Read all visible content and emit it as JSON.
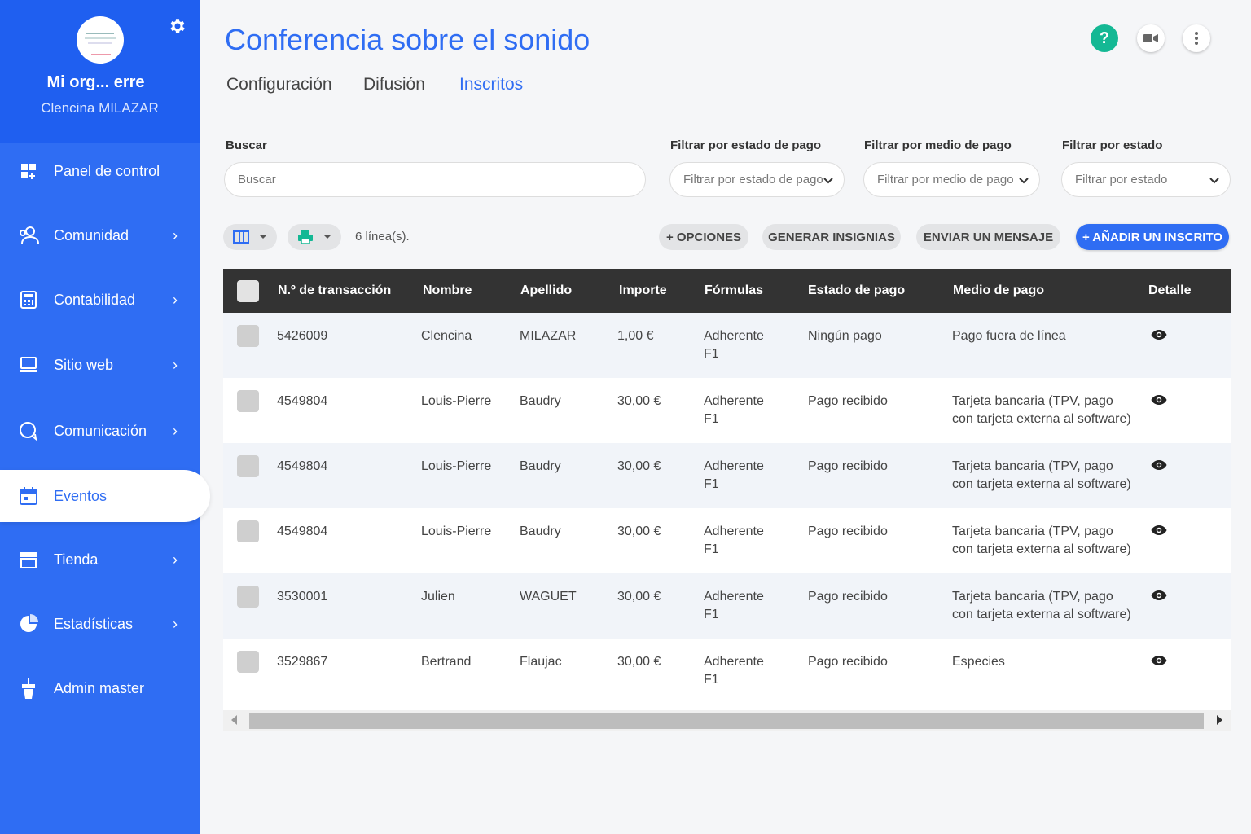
{
  "sidebar": {
    "org_name": "Mi org... erre",
    "user_name": "Clencina MILAZAR",
    "items": [
      {
        "label": "Panel de control",
        "icon": "dashboard-icon"
      },
      {
        "label": "Comunidad",
        "icon": "community-icon"
      },
      {
        "label": "Contabilidad",
        "icon": "accounting-icon"
      },
      {
        "label": "Sitio web",
        "icon": "website-icon"
      },
      {
        "label": "Comunicación",
        "icon": "chat-icon"
      },
      {
        "label": "Eventos",
        "icon": "calendar-icon"
      },
      {
        "label": "Tienda",
        "icon": "store-icon"
      },
      {
        "label": "Estadísticas",
        "icon": "stats-icon"
      },
      {
        "label": "Admin master",
        "icon": "admin-icon"
      }
    ],
    "chevron": "›"
  },
  "header": {
    "title": "Conferencia sobre el sonido",
    "help_label": "?",
    "tabs": [
      {
        "label": "Configuración"
      },
      {
        "label": "Difusión"
      },
      {
        "label": "Inscritos"
      }
    ]
  },
  "filters": {
    "search_label": "Buscar",
    "search_placeholder": "Buscar",
    "pay_status_label": "Filtrar por estado de pago",
    "pay_status_value": "Filtrar por estado de pago",
    "pay_method_label": "Filtrar por medio de pago",
    "pay_method_value": "Filtrar por medio de pago",
    "status_label": "Filtrar por estado",
    "status_value": "Filtrar por estado"
  },
  "toolbar": {
    "rows_count": "6 línea(s).",
    "options": "+ OPCIONES",
    "badges": "GENERAR INSIGNIAS",
    "message": "ENVIAR UN MENSAJE",
    "add": "+ AÑADIR UN INSCRITO"
  },
  "table": {
    "columns": [
      "N.º de transacción",
      "Nombre",
      "Apellido",
      "Importe",
      "Fórmulas",
      "Estado de pago",
      "Medio de pago",
      "Detalle"
    ],
    "rows": [
      {
        "id": "5426009",
        "first": "Clencina",
        "last": "MILAZAR",
        "amount": "1,00 €",
        "formula1": "Adherente",
        "formula2": "F1",
        "status": "Ningún pago",
        "method1": "Pago fuera de línea",
        "method2": ""
      },
      {
        "id": "4549804",
        "first": "Louis-Pierre",
        "last": "Baudry",
        "amount": "30,00 €",
        "formula1": "Adherente",
        "formula2": "F1",
        "status": "Pago recibido",
        "method1": "Tarjeta bancaria (TPV, pago",
        "method2": "con tarjeta externa al software)"
      },
      {
        "id": "4549804",
        "first": "Louis-Pierre",
        "last": "Baudry",
        "amount": "30,00 €",
        "formula1": "Adherente",
        "formula2": "F1",
        "status": "Pago recibido",
        "method1": "Tarjeta bancaria (TPV, pago",
        "method2": "con tarjeta externa al software)"
      },
      {
        "id": "4549804",
        "first": "Louis-Pierre",
        "last": "Baudry",
        "amount": "30,00 €",
        "formula1": "Adherente",
        "formula2": "F1",
        "status": "Pago recibido",
        "method1": "Tarjeta bancaria (TPV, pago",
        "method2": "con tarjeta externa al software)"
      },
      {
        "id": "3530001",
        "first": "Julien",
        "last": "WAGUET",
        "amount": "30,00 €",
        "formula1": "Adherente",
        "formula2": "F1",
        "status": "Pago recibido",
        "method1": "Tarjeta bancaria (TPV, pago",
        "method2": "con tarjeta externa al software)"
      },
      {
        "id": "3529867",
        "first": "Bertrand",
        "last": "Flaujac",
        "amount": "30,00 €",
        "formula1": "Adherente",
        "formula2": "F1",
        "status": "Pago recibido",
        "method1": "Especies",
        "method2": ""
      }
    ]
  },
  "colors": {
    "accent": "#2f6df3",
    "help": "#14b894",
    "header_dark": "#333333"
  }
}
